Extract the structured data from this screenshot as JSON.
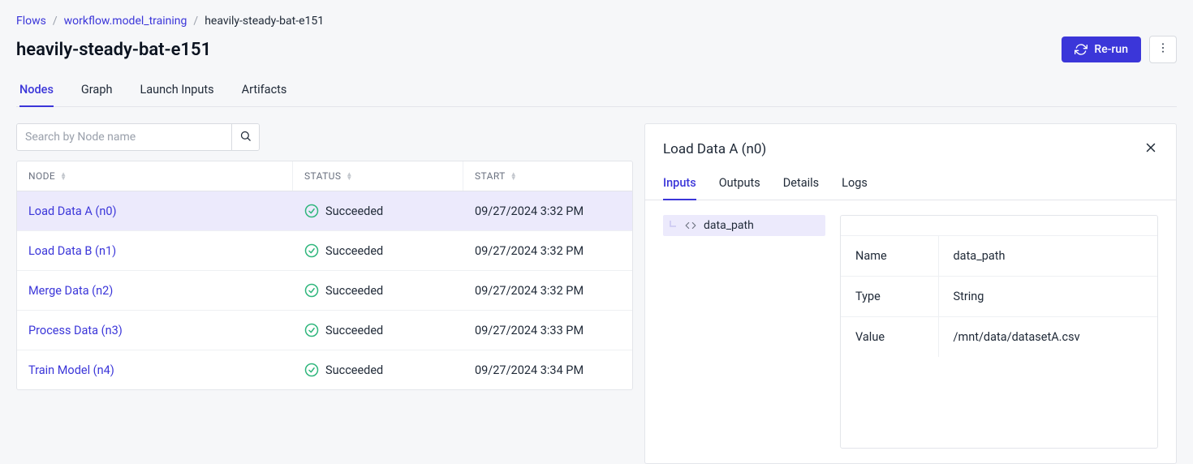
{
  "breadcrumbs": {
    "root": "Flows",
    "workflow": "workflow.model_training",
    "current": "heavily-steady-bat-e151"
  },
  "page_title": "heavily-steady-bat-e151",
  "header": {
    "rerun_label": "Re-run"
  },
  "main_tabs": [
    "Nodes",
    "Graph",
    "Launch Inputs",
    "Artifacts"
  ],
  "search": {
    "placeholder": "Search by Node name"
  },
  "node_table": {
    "columns": [
      "NODE",
      "STATUS",
      "START"
    ],
    "rows": [
      {
        "name": "Load Data A (n0)",
        "status": "Succeeded",
        "start": "09/27/2024 3:32 PM",
        "selected": true
      },
      {
        "name": "Load Data B (n1)",
        "status": "Succeeded",
        "start": "09/27/2024 3:32 PM",
        "selected": false
      },
      {
        "name": "Merge Data (n2)",
        "status": "Succeeded",
        "start": "09/27/2024 3:32 PM",
        "selected": false
      },
      {
        "name": "Process Data (n3)",
        "status": "Succeeded",
        "start": "09/27/2024 3:33 PM",
        "selected": false
      },
      {
        "name": "Train Model (n4)",
        "status": "Succeeded",
        "start": "09/27/2024 3:34 PM",
        "selected": false
      }
    ]
  },
  "detail": {
    "title": "Load Data A (n0)",
    "tabs": [
      "Inputs",
      "Outputs",
      "Details",
      "Logs"
    ],
    "params": [
      {
        "name": "data_path"
      }
    ],
    "param_details": {
      "Name": "data_path",
      "Type": "String",
      "Value": "/mnt/data/datasetA.csv"
    }
  }
}
